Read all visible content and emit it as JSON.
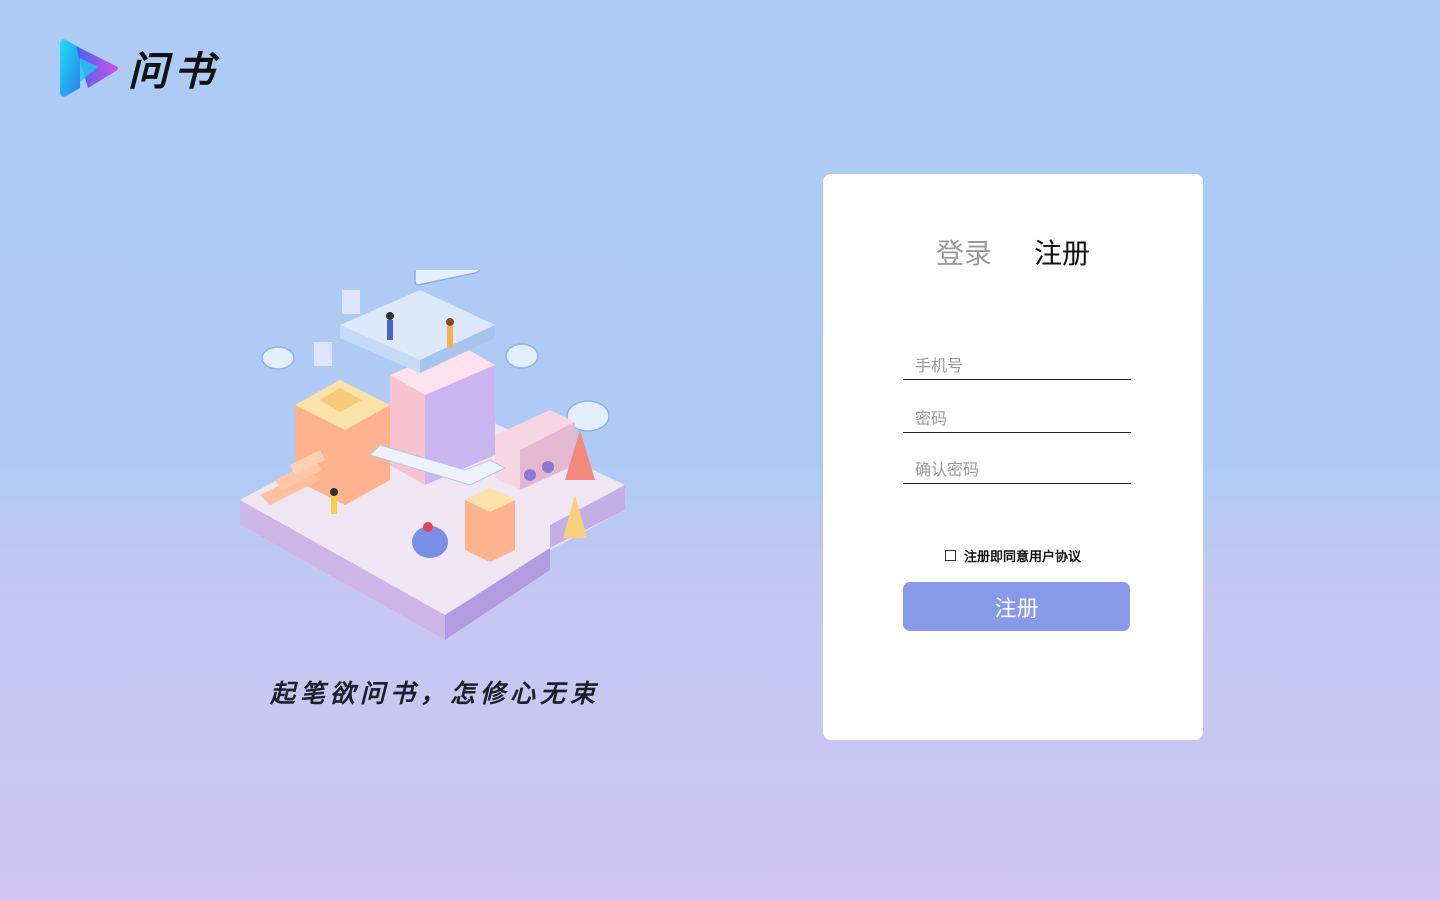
{
  "brand": {
    "name": "问书",
    "icon": "play-logo-icon"
  },
  "illustration": {
    "icon": "isometric-city-illustration"
  },
  "slogan": "起笔欲问书，怎修心无束",
  "auth": {
    "tabs": [
      {
        "label": "登录",
        "active": false
      },
      {
        "label": "注册",
        "active": true
      }
    ],
    "fields": {
      "phone": {
        "placeholder": "手机号",
        "value": ""
      },
      "password": {
        "placeholder": "密码",
        "value": ""
      },
      "confirm_password": {
        "placeholder": "确认密码",
        "value": ""
      }
    },
    "agreement": {
      "label": "注册即同意用户协议",
      "checked": false
    },
    "submit_label": "注册"
  },
  "colors": {
    "bg_top": "#aecbf5",
    "bg_bottom": "#cec5f1",
    "button": "#8999ea",
    "card": "#ffffff"
  }
}
